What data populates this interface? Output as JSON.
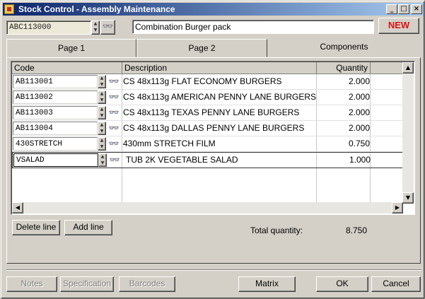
{
  "window": {
    "title": "Stock Control - Assembly Maintenance",
    "controls": [
      "_",
      "□",
      "×"
    ]
  },
  "header": {
    "code_value": "ABC113000",
    "description_value": "Combination Burger pack",
    "new_label": "NEW"
  },
  "tabs": [
    {
      "label": "Page 1"
    },
    {
      "label": "Page 2"
    },
    {
      "label": "Components"
    }
  ],
  "grid": {
    "columns": [
      "Code",
      "Description",
      "Quantity"
    ],
    "rows": [
      {
        "code": "AB113001",
        "description": "CS 48x113g FLAT ECONOMY BURGERS",
        "quantity": "2.000"
      },
      {
        "code": "AB113002",
        "description": "CS 48x113g AMERICAN PENNY LANE BURGERS",
        "quantity": "2.000"
      },
      {
        "code": "AB113003",
        "description": "CS 48x113g TEXAS PENNY LANE BURGERS",
        "quantity": "2.000"
      },
      {
        "code": "AB113004",
        "description": "CS 48x113g DALLAS PENNY LANE BURGERS",
        "quantity": "2.000"
      },
      {
        "code": "430STRETCH",
        "description": "430mm STRETCH FILM",
        "quantity": "0.750"
      },
      {
        "code": "VSALAD",
        "description": "TUB 2K VEGETABLE SALAD",
        "quantity": "1.000"
      }
    ]
  },
  "actions": {
    "delete_line": "Delete line",
    "add_line": "Add line",
    "total_label": "Total quantity:",
    "total_value": "8.750"
  },
  "footer": {
    "notes": "Notes",
    "specification": "Specification",
    "barcodes": "Barcodes",
    "matrix": "Matrix",
    "ok": "OK",
    "cancel": "Cancel"
  }
}
